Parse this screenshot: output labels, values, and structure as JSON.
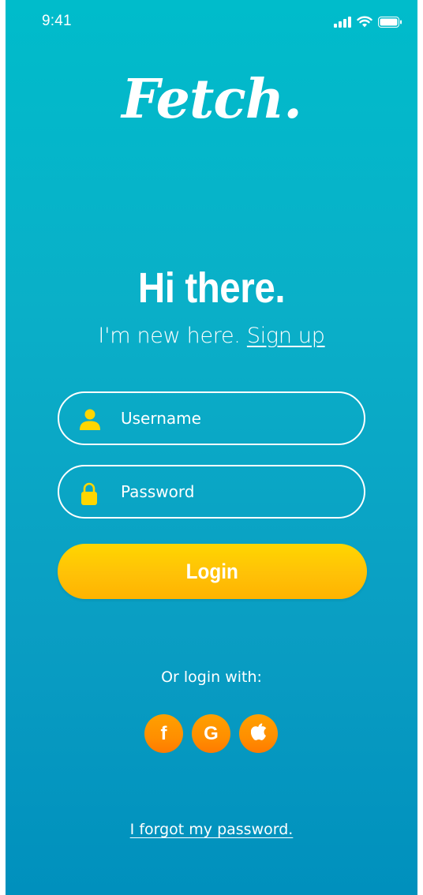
{
  "status_bar": {
    "time": "9:41",
    "icons": [
      "signal-icon",
      "wifi-icon",
      "battery-icon"
    ]
  },
  "brand": {
    "logo_text": "Fetch."
  },
  "greeting": {
    "title": "Hi there.",
    "new_here": "I'm new here.",
    "signup_label": "Sign up"
  },
  "form": {
    "username_placeholder": "Username",
    "password_placeholder": "Password",
    "username_icon": "user-icon",
    "password_icon": "lock-icon",
    "login_label": "Login"
  },
  "social": {
    "prompt": "Or login with:",
    "providers": [
      {
        "name": "facebook",
        "glyph": "f",
        "icon": "facebook-icon"
      },
      {
        "name": "google",
        "glyph": "G",
        "icon": "google-icon"
      },
      {
        "name": "apple",
        "glyph": "",
        "icon": "apple-icon"
      }
    ]
  },
  "forgot_password": "I forgot my password.",
  "colors": {
    "background_top": "#00BCCB",
    "background_bottom": "#0090BD",
    "accent_yellow": "#FFC107",
    "icon_yellow": "#FFD600",
    "social_orange": "#FF8F00"
  }
}
